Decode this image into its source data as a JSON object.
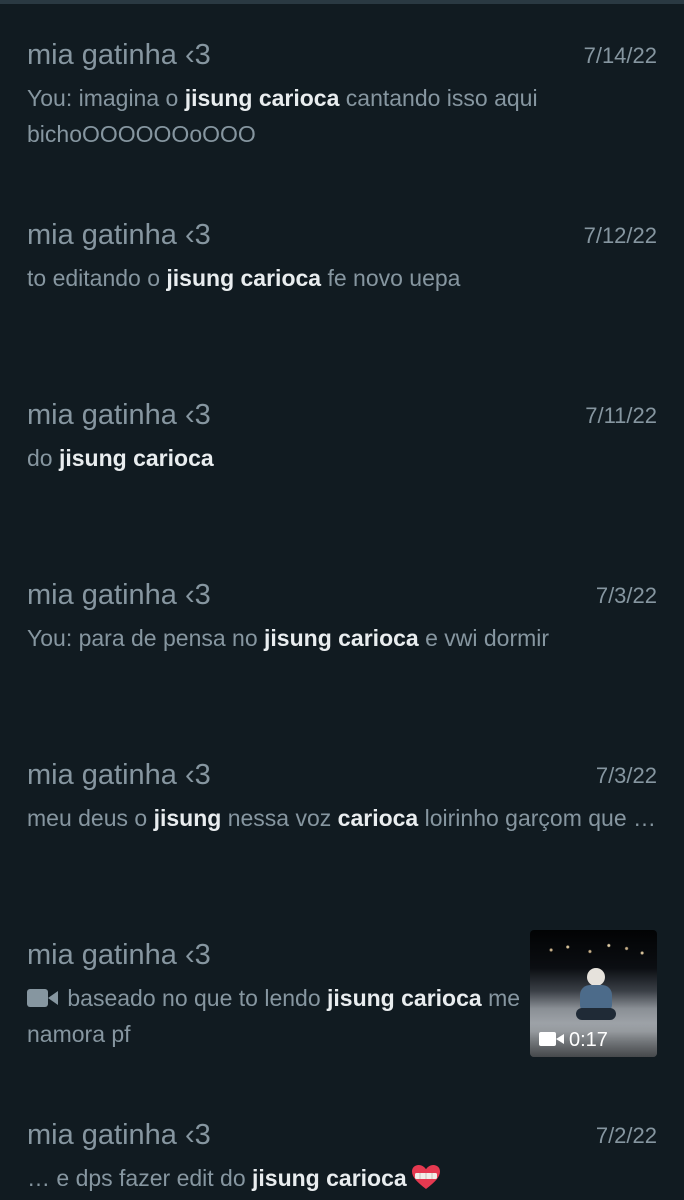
{
  "colors": {
    "background": "#111b21",
    "secondary_text": "#8696a0",
    "highlight_text": "#e9edef",
    "heart": "#e53950"
  },
  "results": [
    {
      "name": "mia gatinha ‹3",
      "date": "7/14/22",
      "preview": [
        "You: imagina o ",
        "jisung carioca",
        " cantando isso aqui bichoOOOOOOoOOO"
      ]
    },
    {
      "name": "mia gatinha ‹3",
      "date": "7/12/22",
      "preview": [
        "to editando o ",
        "jisung carioca",
        " fe novo uepa"
      ]
    },
    {
      "name": "mia gatinha ‹3",
      "date": "7/11/22",
      "preview": [
        "do ",
        "jisung carioca"
      ]
    },
    {
      "name": "mia gatinha ‹3",
      "date": "7/3/22",
      "preview": [
        "You: para de pensa no ",
        "jisung carioca",
        " e vwi dormir"
      ]
    },
    {
      "name": "mia gatinha ‹3",
      "date": "7/3/22",
      "preview": [
        "meu deus o ",
        "jisung",
        " nessa voz ",
        "carioca",
        " loirinho garçom que …"
      ]
    },
    {
      "name": "mia gatinha ‹3",
      "preview": [
        " baseado no que to lendo ",
        "jisung carioca",
        " me namora pf"
      ],
      "media_icon": "video-camera-icon",
      "thumbnail_duration": "0:17",
      "thumbnail_icon": "video-camera-icon"
    },
    {
      "name": "mia gatinha ‹3",
      "date": "7/2/22",
      "preview": [
        "… e dps fazer edit do ",
        "jisung carioca"
      ],
      "emoji_icon": "mending-heart-icon"
    }
  ]
}
